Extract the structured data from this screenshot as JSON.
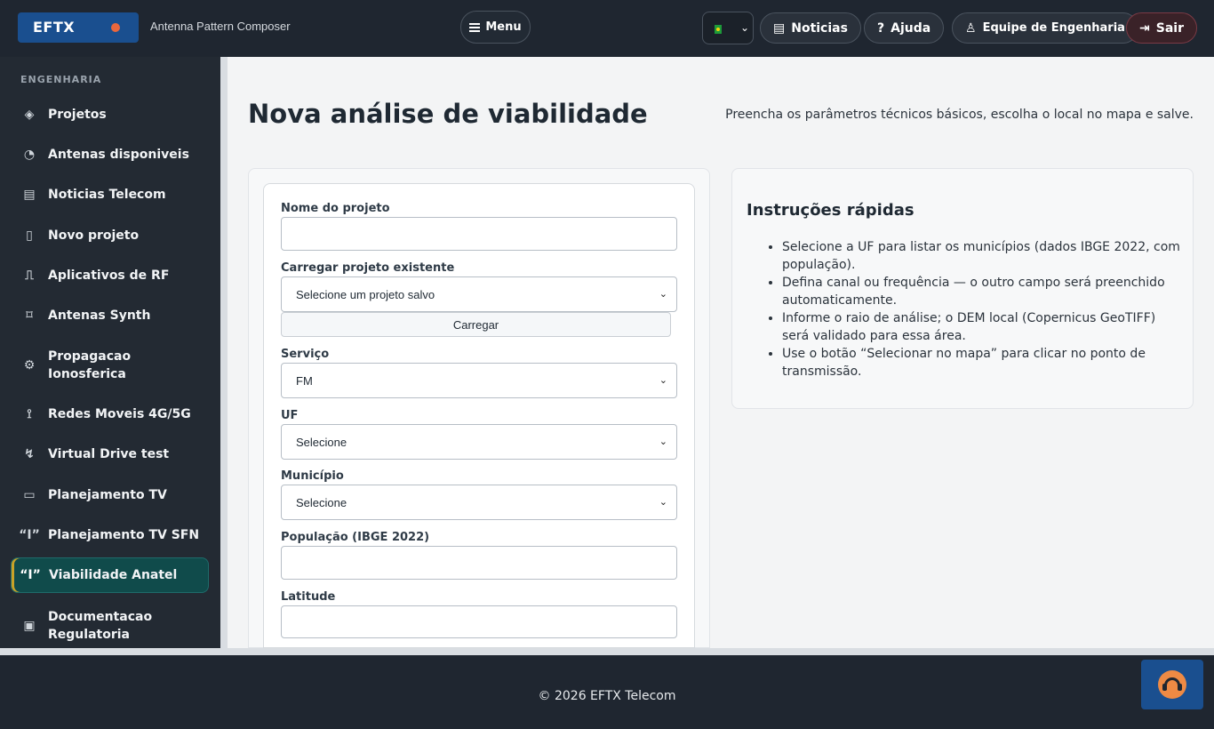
{
  "header": {
    "brand": "EFTX",
    "app_subtitle": "Antenna Pattern Composer",
    "menu_label": "Menu",
    "language_flag": "brazil-flag",
    "news_label": "Noticias",
    "help_label": "Ajuda",
    "team_label": "Equipe de Engenharia",
    "exit_label": "Sair",
    "colors": {
      "bar": "#1f2630",
      "brand": "#1a4f8f",
      "brand_dot": "#e9673d"
    }
  },
  "sidebar": {
    "section": "ENGENHARIA",
    "items": [
      {
        "label": "Projetos",
        "icon": "layers-icon"
      },
      {
        "label": "Antenas disponiveis",
        "icon": "satellite-dish-icon"
      },
      {
        "label": "Noticias Telecom",
        "icon": "newspaper-icon"
      },
      {
        "label": "Novo projeto",
        "icon": "file-plus-icon"
      },
      {
        "label": "Aplicativos de RF",
        "icon": "pulse-icon"
      },
      {
        "label": "Antenas Synth",
        "icon": "vector-icon"
      },
      {
        "label": "Propagacao Ionosferica",
        "icon": "gear-icon"
      },
      {
        "label": "Redes Moveis 4G/5G",
        "icon": "tower-icon"
      },
      {
        "label": "Virtual Drive test",
        "icon": "route-icon"
      },
      {
        "label": "Planejamento TV",
        "icon": "monitor-icon"
      },
      {
        "label": "Planejamento TV SFN",
        "icon": "broadcast-icon"
      },
      {
        "label": "Viabilidade Anatel",
        "icon": "broadcast-icon",
        "active": true
      },
      {
        "label": "Documentacao Regulatoria",
        "icon": "clipboard-icon"
      }
    ],
    "active_color": "#104b4b"
  },
  "main": {
    "title": "Nova análise de viabilidade",
    "hint": "Preencha os parâmetros técnicos básicos, escolha o local no mapa e salve."
  },
  "form": {
    "project_name_label": "Nome do projeto",
    "project_name_value": "",
    "load_existing_label": "Carregar projeto existente",
    "load_existing_selected": "Selecione um projeto salvo",
    "load_button": "Carregar",
    "service_label": "Serviço",
    "service_selected": "FM",
    "uf_label": "UF",
    "uf_selected": "Selecione",
    "city_label": "Município",
    "city_selected": "Selecione",
    "population_label": "População (IBGE 2022)",
    "population_value": "",
    "latitude_label": "Latitude",
    "latitude_value": ""
  },
  "instructions": {
    "title": "Instruções rápidas",
    "items": [
      "Selecione a UF para listar os municípios (dados IBGE 2022, com população).",
      "Defina canal ou frequência — o outro campo será preenchido automaticamente.",
      "Informe o raio de análise; o DEM local (Copernicus GeoTIFF) será validado para essa área.",
      "Use o botão “Selecionar no mapa” para clicar no ponto de transmissão."
    ]
  },
  "footer": {
    "copyright": "© 2026 EFTX Telecom",
    "support_icon": "headset-icon"
  }
}
